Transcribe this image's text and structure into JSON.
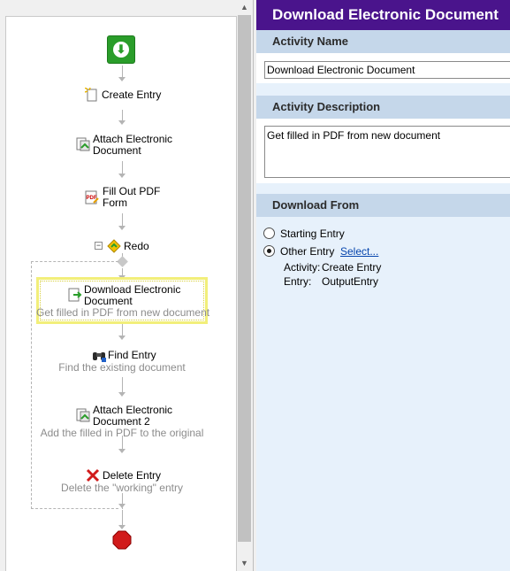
{
  "workflow": {
    "nodes": [
      {
        "title": "Create Entry",
        "desc": ""
      },
      {
        "title": "Attach Electronic Document",
        "title_lines": [
          "Attach Electronic",
          "Document"
        ],
        "desc": ""
      },
      {
        "title": "Fill Out PDF Form",
        "title_lines": [
          "Fill Out PDF",
          "Form"
        ],
        "desc": ""
      },
      {
        "title": "Redo",
        "desc": ""
      },
      {
        "title": "Download Electronic Document",
        "title_lines": [
          "Download Electronic",
          "Document"
        ],
        "desc": "Get filled in PDF from new document",
        "selected": true
      },
      {
        "title": "Find Entry",
        "desc": "Find the existing document"
      },
      {
        "title": "Attach Electronic Document 2",
        "title_lines": [
          "Attach Electronic",
          "Document 2"
        ],
        "desc": "Add the filled in PDF to the original"
      },
      {
        "title": "Delete Entry",
        "desc": "Delete the \"working\" entry"
      }
    ],
    "icons": {
      "start": "download-arrow-icon",
      "create": "new-entry-icon",
      "attach": "attach-document-icon",
      "pdf": "pdf-form-icon",
      "redo": "redo-diamond-icon",
      "download": "download-document-icon",
      "find": "binoculars-icon",
      "delete": "red-x-icon",
      "stop": "stop-sign-icon"
    }
  },
  "properties": {
    "title": "Download Electronic Document",
    "activity_name": {
      "label": "Activity Name",
      "value": "Download Electronic Document"
    },
    "activity_description": {
      "label": "Activity Description",
      "value": "Get filled in PDF from new document"
    },
    "download_from": {
      "label": "Download From",
      "options": [
        {
          "label": "Starting Entry",
          "checked": false
        },
        {
          "label": "Other Entry",
          "checked": true
        }
      ],
      "select_link": "Select...",
      "activity_label": "Activity:",
      "activity_value": "Create Entry",
      "entry_label": "Entry:",
      "entry_value": "OutputEntry"
    }
  },
  "colors": {
    "header_bg": "#4a148c",
    "section_bg": "#c5d7ea",
    "panel_bg": "#e7f1fb",
    "selection": "#f2ef7a",
    "start_green": "#2a9d2a",
    "stop_red": "#d11b1b"
  }
}
